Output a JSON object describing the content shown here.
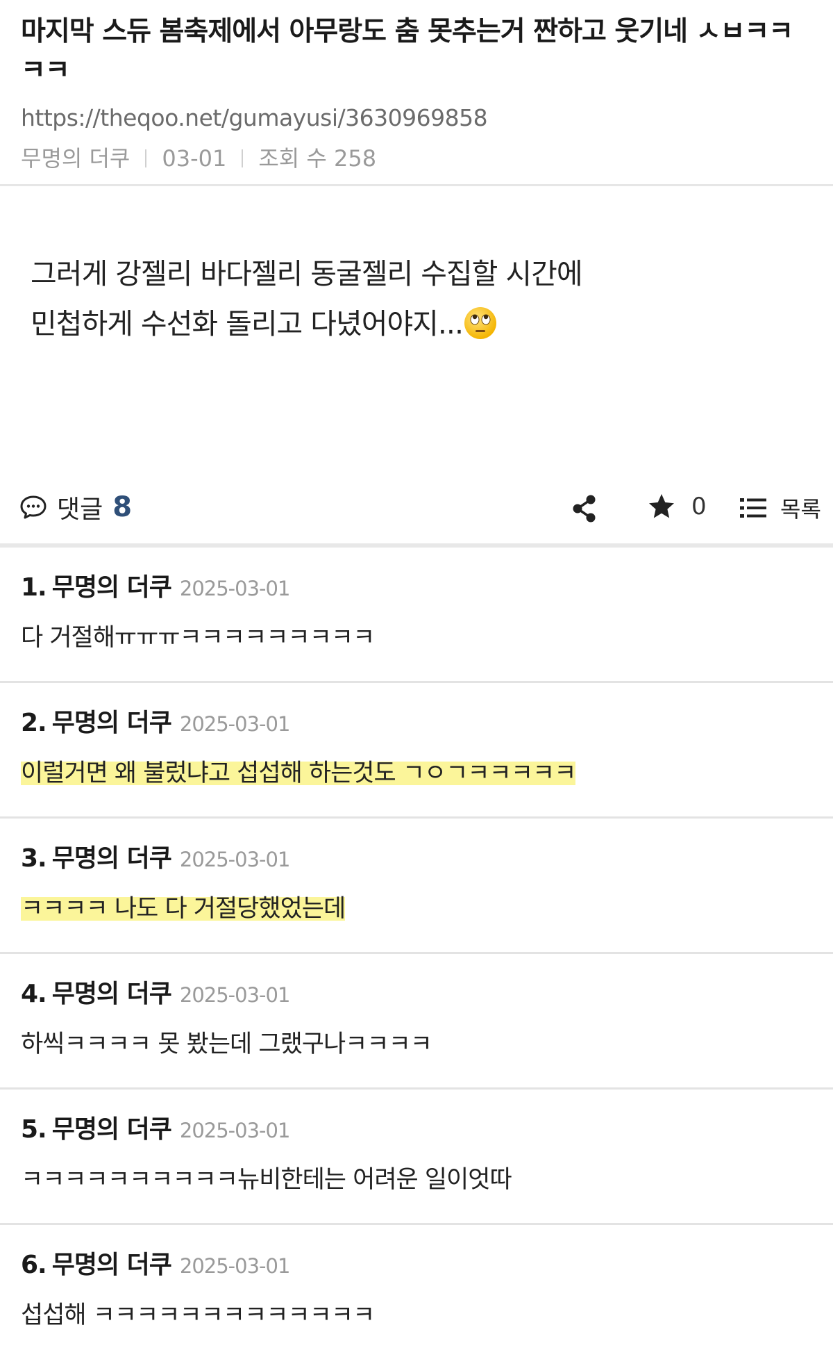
{
  "post": {
    "title": "마지막 스듀 봄축제에서 아무랑도 춤 못추는거 짠하고 웃기네 ㅅㅂㅋㅋㅋㅋ",
    "url": "https://theqoo.net/gumayusi/3630969858",
    "author": "무명의 더쿠",
    "date": "03-01",
    "views_label": "조회 수 258",
    "body_line1": "그러게 강젤리 바다젤리 동굴젤리 수집할 시간에",
    "body_line2": "민첩하게 수선화 돌리고 다녔어야지...",
    "body_emoji": "face-with-rolling-eyes"
  },
  "actions": {
    "comment_label": "댓글",
    "comment_count": "8",
    "star_count": "0",
    "list_label": "목록"
  },
  "comments": [
    {
      "number": "1.",
      "author": "무명의 더쿠",
      "date": "2025-03-01",
      "text": "다 거절해ㅠㅠㅠㅋㅋㅋㅋㅋㅋㅋㅋㅋ",
      "highlight": false
    },
    {
      "number": "2.",
      "author": "무명의 더쿠",
      "date": "2025-03-01",
      "text": "이럴거면 왜 불렀냐고 섭섭해 하는것도 ㄱㅇㄱㅋㅋㅋㅋㅋ",
      "highlight": true
    },
    {
      "number": "3.",
      "author": "무명의 더쿠",
      "date": "2025-03-01",
      "text": "ㅋㅋㅋㅋ 나도 다 거절당했었는데",
      "highlight": true
    },
    {
      "number": "4.",
      "author": "무명의 더쿠",
      "date": "2025-03-01",
      "text": "하씩ㅋㅋㅋㅋ 못 봤는데 그랬구나ㅋㅋㅋㅋ",
      "highlight": false
    },
    {
      "number": "5.",
      "author": "무명의 더쿠",
      "date": "2025-03-01",
      "text": "ㅋㅋㅋㅋㅋㅋㅋㅋㅋㅋ뉴비한테는 어려운 일이엇따",
      "highlight": false
    },
    {
      "number": "6.",
      "author": "무명의 더쿠",
      "date": "2025-03-01",
      "text": "섭섭해 ㅋㅋㅋㅋㅋㅋㅋㅋㅋㅋㅋㅋㅋ",
      "highlight": false
    }
  ],
  "colors": {
    "comment_count": "#2f4f78",
    "highlight": "#fbf59a",
    "divider": "#e3e3e3"
  }
}
